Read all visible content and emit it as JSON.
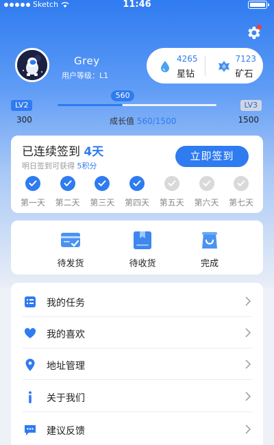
{
  "status_bar": {
    "carrier": "Sketch",
    "time": "11:46"
  },
  "profile": {
    "name": "Grey",
    "level_label": "用户等级：L1"
  },
  "assets": [
    {
      "value": "4265",
      "label": "星钻",
      "icon": "drop-icon"
    },
    {
      "value": "7123",
      "label": "矿石",
      "icon": "ore-icon"
    }
  ],
  "level": {
    "current_badge": "LV2",
    "next_badge": "LV3",
    "bubble_value": "560",
    "min": "300",
    "max": "1500",
    "growth_label": "成长值",
    "growth_current": "560",
    "growth_total": "/1500",
    "progress_fraction": 0.41
  },
  "signin": {
    "title_prefix": "已连续签到",
    "days": "4天",
    "sub_prefix": "明日签到可获得",
    "sub_points": "5积分",
    "button": "立即签到",
    "week": [
      {
        "label": "第一天",
        "done": true
      },
      {
        "label": "第二天",
        "done": true
      },
      {
        "label": "第三天",
        "done": true
      },
      {
        "label": "第四天",
        "done": true
      },
      {
        "label": "第五天",
        "done": false
      },
      {
        "label": "第六天",
        "done": false
      },
      {
        "label": "第七天",
        "done": false
      }
    ]
  },
  "orders": [
    {
      "label": "待发货",
      "icon": "card-icon"
    },
    {
      "label": "待收货",
      "icon": "box-icon"
    },
    {
      "label": "完成",
      "icon": "bag-icon"
    }
  ],
  "menu": [
    {
      "label": "我的任务",
      "icon": "task-list-icon"
    },
    {
      "label": "我的喜欢",
      "icon": "heart-icon"
    },
    {
      "label": "地址管理",
      "icon": "location-pin-icon"
    },
    {
      "label": "关于我们",
      "icon": "info-icon"
    },
    {
      "label": "建议反馈",
      "icon": "message-icon"
    }
  ],
  "colors": {
    "accent": "#2f7bf0",
    "bg": "#eef2f8",
    "check_off": "#d9d9d9"
  }
}
